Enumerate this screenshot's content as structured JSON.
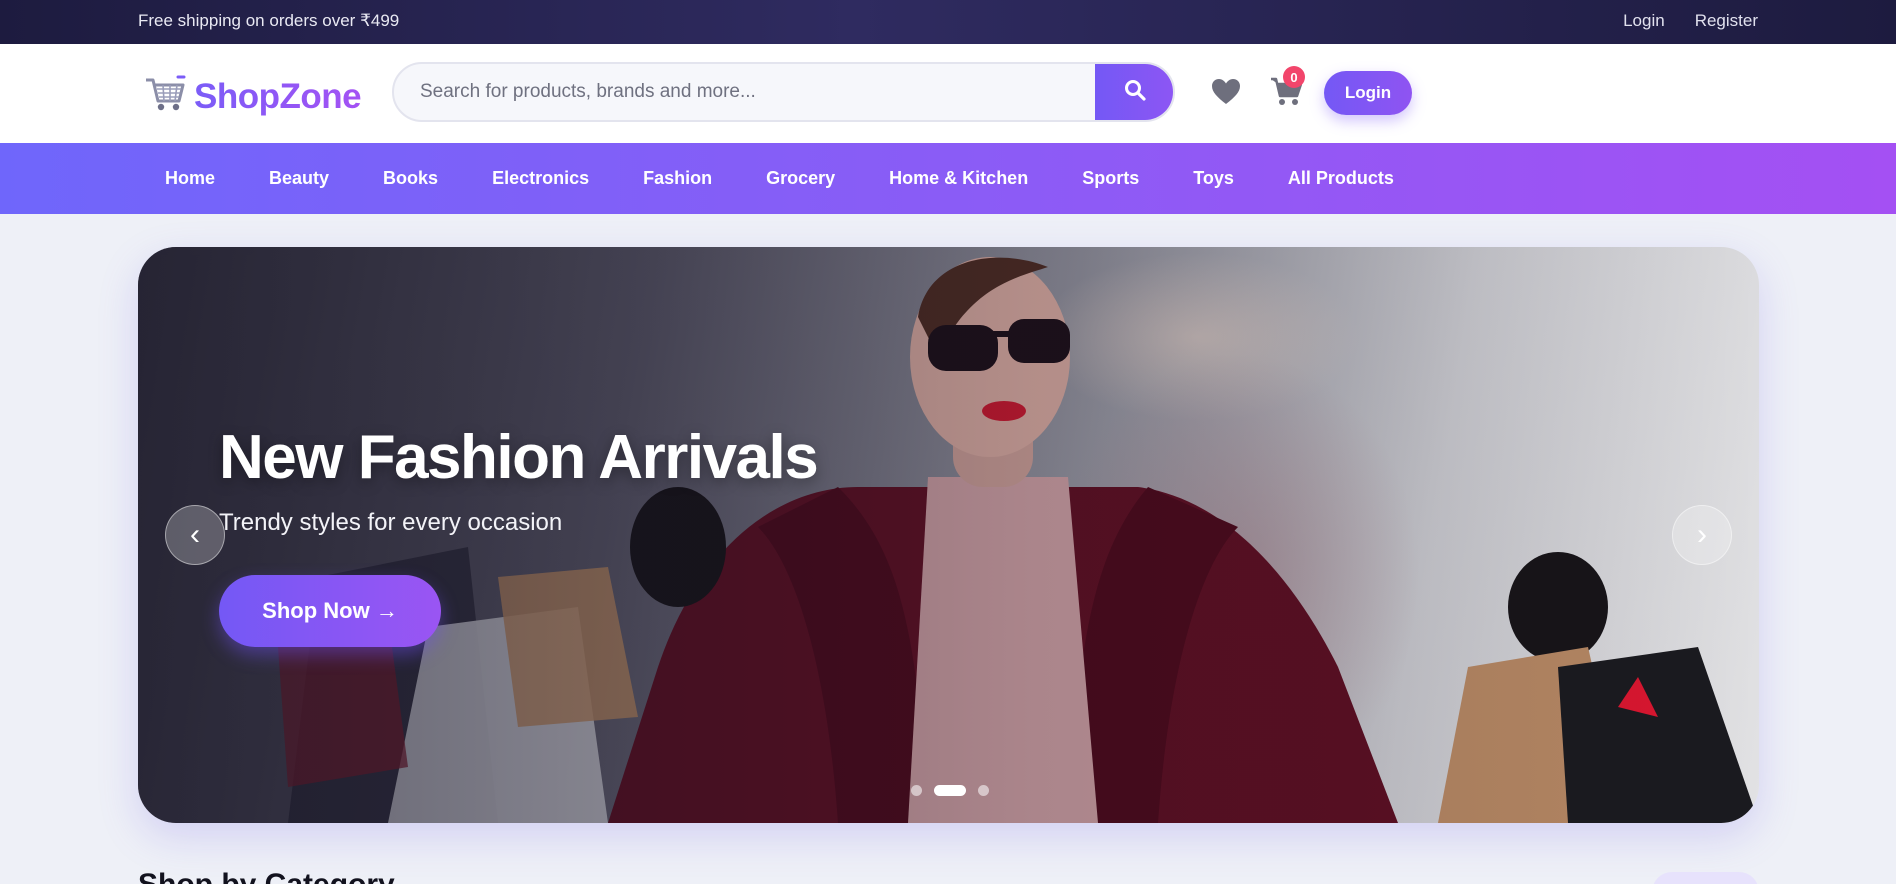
{
  "topbar": {
    "promo": "Free shipping on orders over ₹499",
    "login_link": "Login",
    "register_link": "Register"
  },
  "header": {
    "logo_text": "ShopZone",
    "search": {
      "placeholder": "Search for products, brands and more...",
      "value": ""
    },
    "cart_count": "0",
    "login_button": "Login"
  },
  "nav": {
    "items": [
      {
        "label": "Home"
      },
      {
        "label": "Beauty"
      },
      {
        "label": "Books"
      },
      {
        "label": "Electronics"
      },
      {
        "label": "Fashion"
      },
      {
        "label": "Grocery"
      },
      {
        "label": "Home & Kitchen"
      },
      {
        "label": "Sports"
      },
      {
        "label": "Toys"
      },
      {
        "label": "All Products"
      }
    ]
  },
  "hero": {
    "title": "New Fashion Arrivals",
    "subtitle": "Trendy styles for every occasion",
    "cta": "Shop Now →",
    "prev_arrow": "‹",
    "next_arrow": "›",
    "slide_count": 3,
    "active_slide": 2
  },
  "section": {
    "title": "Shop by Category"
  },
  "icons": {
    "logo": "shopping-cart-icon",
    "search": "search-icon",
    "wishlist": "heart-icon",
    "cart": "cart-icon"
  },
  "colors": {
    "accent": "#7b5cf7",
    "accent_end": "#a450f3",
    "topbar_bg": "#1d1b3f",
    "badge": "#f2456b",
    "page_bg": "#eef0f7"
  }
}
